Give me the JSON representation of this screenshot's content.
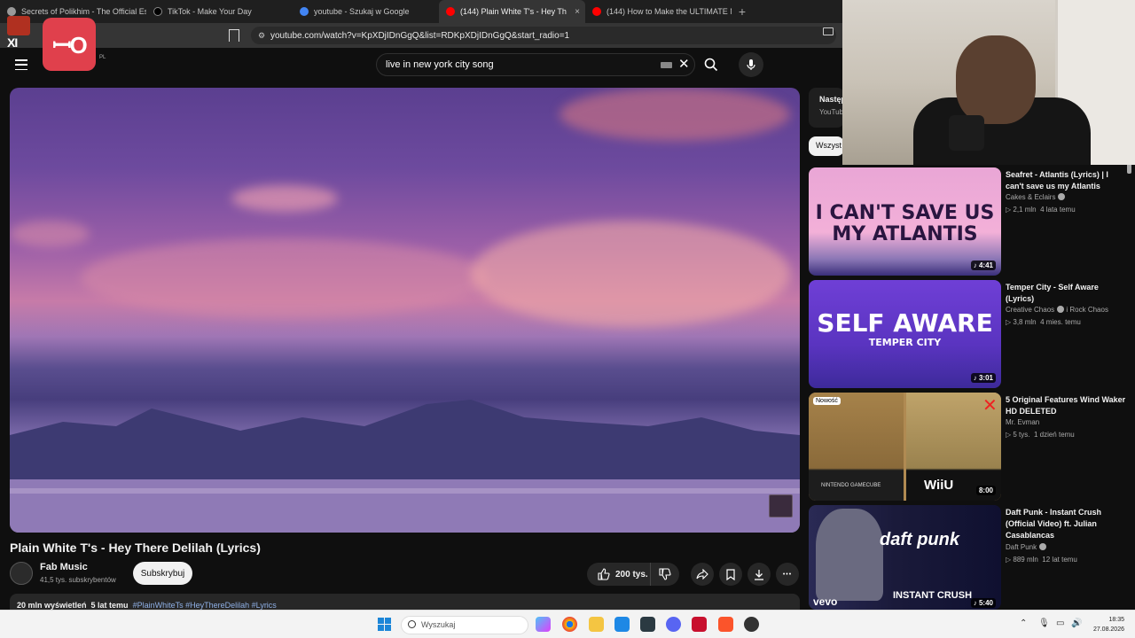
{
  "browser": {
    "tabs": [
      {
        "title": "Secrets of Polikhim - The Official Esc",
        "active": false,
        "favicon_color": "#9a9a9a"
      },
      {
        "title": "TikTok - Make Your Day",
        "active": false,
        "favicon_color": "#000000"
      },
      {
        "title": "youtube - Szukaj w Google",
        "active": false,
        "favicon_color": "#4285f4"
      },
      {
        "title": "(144) Plain White T's - Hey Th",
        "active": true,
        "favicon_color": "#ff0000"
      },
      {
        "title": "(144) How to Make the ULTIMATE M",
        "active": false,
        "favicon_color": "#ff0000"
      }
    ],
    "new_tab": "+",
    "close_glyph": "×",
    "url": "youtube.com/watch?v=KpXDjIDnGgQ&list=RDKpXDjIDnGgQ&start_radio=1"
  },
  "overlay": {
    "logo_glyph": "ꟷO",
    "emblem_text": "XI"
  },
  "header": {
    "logo_text": "e",
    "region": "PL",
    "search_value": "live in new york city song",
    "clear_glyph": "✕"
  },
  "video": {
    "title": "Plain White T's - Hey There Delilah (Lyrics)",
    "channel": "Fab Music",
    "subscribers": "41,5 tys. subskrybentów",
    "subscribe_label": "Subskrybuj",
    "likes": "200 tys.",
    "views": "20 mln wyświetleń",
    "age": "5 lat temu",
    "tags": "#PlainWhiteTs #HeyThereDelilah #Lyrics",
    "more_glyph": "•••"
  },
  "sidebar": {
    "next_title": "Następ",
    "next_sub": "YouTub",
    "chip_label": "Wszyst",
    "recommendations": [
      {
        "title": "Seafret - Atlantis (Lyrics) | I can't save us my Atlantis",
        "channel": "Cakes & Eclairs",
        "verified": true,
        "views": "2,1 mln",
        "age": "4 lata temu",
        "duration": "4:41",
        "thumb_text": "I CAN'T SAVE US MY ATLANTIS"
      },
      {
        "title": "Temper City - Self Aware (Lyrics)",
        "channel": "Creative Chaos",
        "channel_suffix": "i Rock Chaos",
        "verified": true,
        "views": "3,8 mln",
        "age": "4 mies. temu",
        "duration": "3:01",
        "thumb_text": "SELF AWARE",
        "thumb_sub": "TEMPER CITY"
      },
      {
        "title": "5 Original Features Wind Waker HD DELETED",
        "channel": "Mr. Evman",
        "verified": false,
        "views": "5 tys.",
        "age": "1 dzień temu",
        "duration": "8:00",
        "badge": "Nowość",
        "thumb_left": "NINTENDO GAMECUBE",
        "thumb_right": "WiiU"
      },
      {
        "title": "Daft Punk - Instant Crush (Official Video) ft. Julian Casablancas",
        "channel": "Daft Punk",
        "verified": true,
        "views": "889 mln",
        "age": "12 lat temu",
        "duration": "5:40",
        "thumb_text": "INSTANT CRUSH",
        "thumb_logo": "daft punk",
        "thumb_corner": "vevo"
      }
    ]
  },
  "taskbar": {
    "search_placeholder": "Wyszukaj",
    "time": "18:35",
    "date": "27.08.2026"
  }
}
